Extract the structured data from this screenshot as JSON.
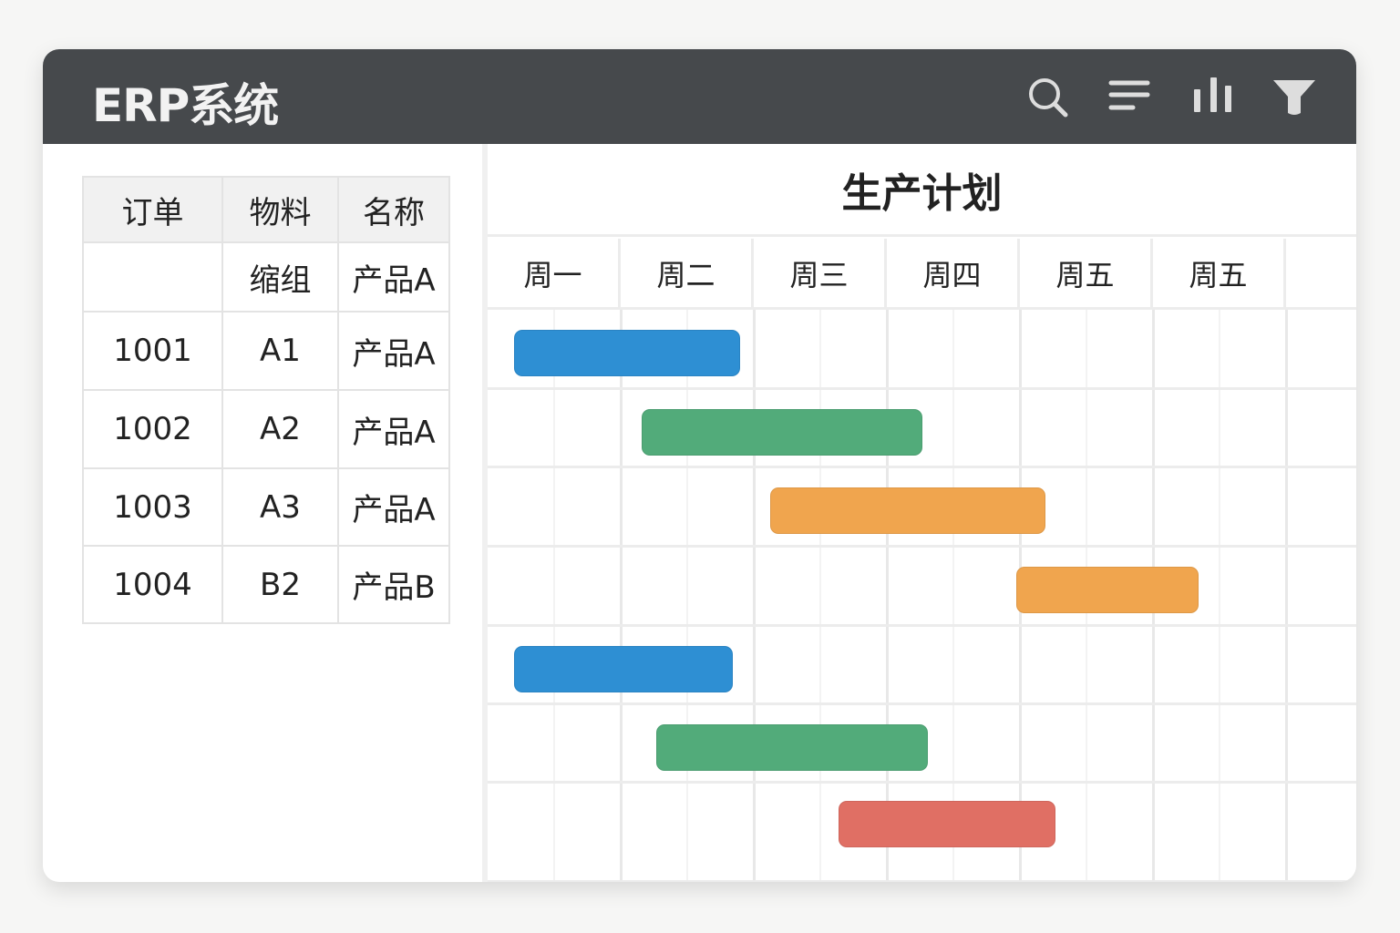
{
  "header": {
    "title": "ERP系统",
    "icons": [
      "search-icon",
      "sort-icon",
      "bar-chart-icon",
      "filter-icon"
    ]
  },
  "table": {
    "headers": [
      "订单",
      "物料",
      "名称"
    ],
    "subheader": [
      "",
      "缩组",
      "产品A"
    ],
    "rows": [
      [
        "1001",
        "A1",
        "产品A"
      ],
      [
        "1002",
        "A2",
        "产品A"
      ],
      [
        "1003",
        "A3",
        "产品A"
      ],
      [
        "1004",
        "B2",
        "产品B"
      ]
    ]
  },
  "chart_data": {
    "type": "gantt",
    "title": "生产计划",
    "days": [
      "周一",
      "周二",
      "周三",
      "周四",
      "周五",
      "周五"
    ],
    "tasks": [
      {
        "row": 0,
        "start": 0.2,
        "end": 1.9,
        "color": "#2e8fd3"
      },
      {
        "row": 1,
        "start": 1.16,
        "end": 3.27,
        "color": "#52ab7a"
      },
      {
        "row": 2,
        "start": 2.12,
        "end": 4.19,
        "color": "#f0a54e"
      },
      {
        "row": 3,
        "start": 3.97,
        "end": 5.34,
        "color": "#f0a54e"
      },
      {
        "row": 4,
        "start": 0.2,
        "end": 1.84,
        "color": "#2e8fd3"
      },
      {
        "row": 5,
        "start": 1.27,
        "end": 3.31,
        "color": "#52ab7a"
      },
      {
        "row": 6,
        "start": 2.64,
        "end": 4.27,
        "color": "#e06f64"
      }
    ]
  }
}
